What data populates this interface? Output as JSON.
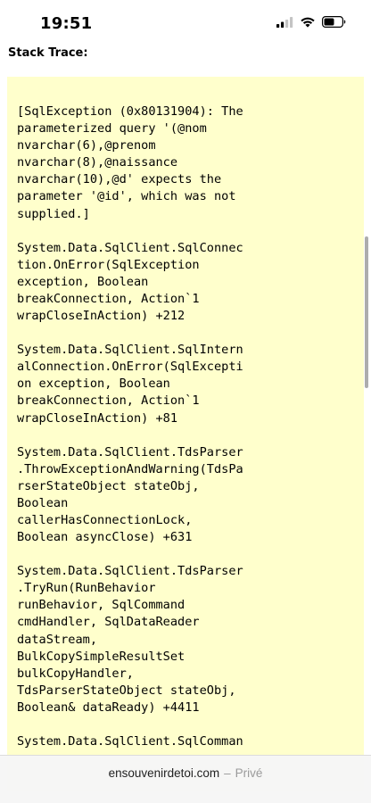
{
  "status_bar": {
    "time": "19:51",
    "icons": [
      "signal-icon",
      "wifi-icon",
      "battery-icon"
    ]
  },
  "page": {
    "heading": "Stack Trace:",
    "trace_background": "#ffffcc",
    "trace_blocks": [
      {
        "lines": [
          "[SqlException (0x80131904): The",
          "parameterized query '(@nom",
          "nvarchar(6),@prenom",
          "nvarchar(8),@naissance",
          "nvarchar(10),@d' expects the",
          "parameter '@id', which was not",
          "supplied.]"
        ]
      },
      {
        "lines": [
          "System.Data.SqlClient.SqlConnec",
          "tion.OnError(SqlException",
          "exception, Boolean",
          "breakConnection, Action`1",
          "wrapCloseInAction) +212"
        ]
      },
      {
        "lines": [
          "System.Data.SqlClient.SqlIntern",
          "alConnection.OnError(SqlExcepti",
          "on exception, Boolean",
          "breakConnection, Action`1",
          "wrapCloseInAction) +81"
        ]
      },
      {
        "lines": [
          "System.Data.SqlClient.TdsParser",
          ".ThrowExceptionAndWarning(TdsPa",
          "rserStateObject stateObj,",
          "Boolean",
          "callerHasConnectionLock,",
          "Boolean asyncClose) +631"
        ]
      },
      {
        "lines": [
          "System.Data.SqlClient.TdsParser",
          ".TryRun(RunBehavior",
          "runBehavior, SqlCommand",
          "cmdHandler, SqlDataReader",
          "dataStream,",
          "BulkCopySimpleResultSet",
          "bulkCopyHandler,",
          "TdsParserStateObject stateObj,",
          "Boolean& dataReady) +4411"
        ]
      },
      {
        "lines": [
          "System.Data.SqlClient.SqlComman"
        ]
      }
    ]
  },
  "url_bar": {
    "domain": "ensouvenirdetoi.com",
    "separator": "–",
    "mode": "Privé"
  }
}
